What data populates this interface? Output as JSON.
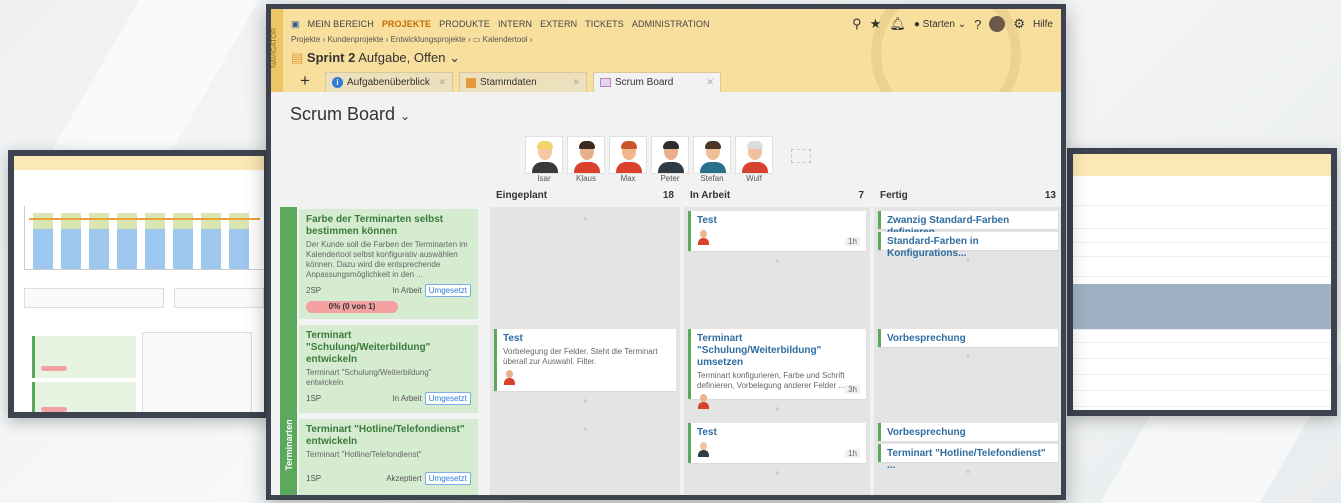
{
  "nav": {
    "strip_label": "NAVIGATOR",
    "items": [
      "MEIN BEREICH",
      "PROJEKTE",
      "PRODUKTE",
      "INTERN",
      "EXTERN",
      "TICKETS",
      "ADMINISTRATION"
    ],
    "active_index": 1,
    "start_label": "Starten",
    "help_label": "Hilfe"
  },
  "breadcrumb": "Projekte › Kundenprojekte › Entwicklungsprojekte › ▭ Kalendertool ›",
  "sprint": {
    "name": "Sprint 2",
    "filter": "Aufgabe, Offen"
  },
  "tabs": [
    {
      "label": "Aufgabenüberblick"
    },
    {
      "label": "Stammdaten"
    },
    {
      "label": "Scrum Board"
    }
  ],
  "page_title": "Scrum Board",
  "people": [
    "Isar",
    "Klaus",
    "Max",
    "Peter",
    "Stefan",
    "Wulf"
  ],
  "columns": [
    {
      "name": "Eingeplant",
      "count": "18"
    },
    {
      "name": "In Arbeit",
      "count": "7"
    },
    {
      "name": "Fertig",
      "count": "13"
    }
  ],
  "swimlane": "Terminarten",
  "stories": [
    {
      "title": "Farbe der Terminarten selbst bestimmen können",
      "desc": "Der Kunde soll die Farben der Terminarten im Kalendertool selbst konfigurativ auswählen können. Dazu wird die entsprechende Anpassungsmöglichkeit in den ...",
      "sp": "2SP",
      "status": "In Arbeit",
      "action": "Umgesetzt",
      "progress": "0% (0 von 1)"
    },
    {
      "title": "Terminart \"Schulung/Weiterbildung\" entwickeln",
      "desc": "Terminart \"Schulung/Weiterbildung\" entwickeln",
      "sp": "1SP",
      "status": "In Arbeit",
      "action": "Umgesetzt"
    },
    {
      "title": "Terminart \"Hotline/Telefondienst\" entwickeln",
      "desc": "Terminart \"Hotline/Telefondienst\"",
      "sp": "1SP",
      "status": "Akzeptiert",
      "action": "Umgesetzt"
    }
  ],
  "cards": {
    "r1_arbeit": {
      "title": "Test",
      "hours": "1h"
    },
    "r1_fertig_1": {
      "title": "Zwanzig Standard-Farben definieren"
    },
    "r1_fertig_2": {
      "title": "Standard-Farben in Konfigurations..."
    },
    "r2_geplant": {
      "title": "Test",
      "desc": "Vorbelegung der Felder. Steht die Terminart überall zur Auswahl. Filter."
    },
    "r2_arbeit": {
      "title": "Terminart \"Schulung/Weiterbildung\" umsetzen",
      "desc": "Terminart konfigurieren, Farbe und Schrift definieren, Vorbelegung anderer Felder ...",
      "hours": "3h"
    },
    "r2_fertig": {
      "title": "Vorbesprechung"
    },
    "r3_arbeit": {
      "title": "Test",
      "hours": "1h"
    },
    "r3_fertig_1": {
      "title": "Vorbesprechung"
    },
    "r3_fertig_2": {
      "title": "Terminart \"Hotline/Telefondienst\" ..."
    }
  },
  "colors": {
    "header": "#f8df9d",
    "accent": "#c56b00",
    "lane_green": "#5ca85c",
    "link_blue": "#2f6da0"
  }
}
